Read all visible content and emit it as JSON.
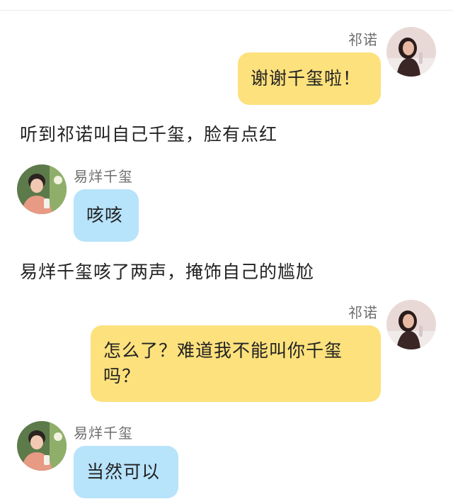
{
  "messages": [
    {
      "sender": "祁诺",
      "text": "谢谢千玺啦！",
      "side": "right",
      "color": "#fde17d",
      "avatar": "girl-avatar"
    },
    {
      "narration": "听到祁诺叫自己千玺，脸有点红"
    },
    {
      "sender": "易烊千玺",
      "text": "咳咳",
      "side": "left",
      "color": "#b7e3fb",
      "avatar": "boy-avatar"
    },
    {
      "narration": "易烊千玺咳了两声，掩饰自己的尴尬"
    },
    {
      "sender": "祁诺",
      "text_line1": "怎么了？难道我不能叫你千玺",
      "text_line2": "吗？",
      "side": "right",
      "color": "#fde17d",
      "avatar": "girl-avatar"
    },
    {
      "sender": "易烊千玺",
      "text": "当然可以",
      "side": "left",
      "color": "#b7e3fb",
      "avatar": "boy-avatar"
    }
  ]
}
